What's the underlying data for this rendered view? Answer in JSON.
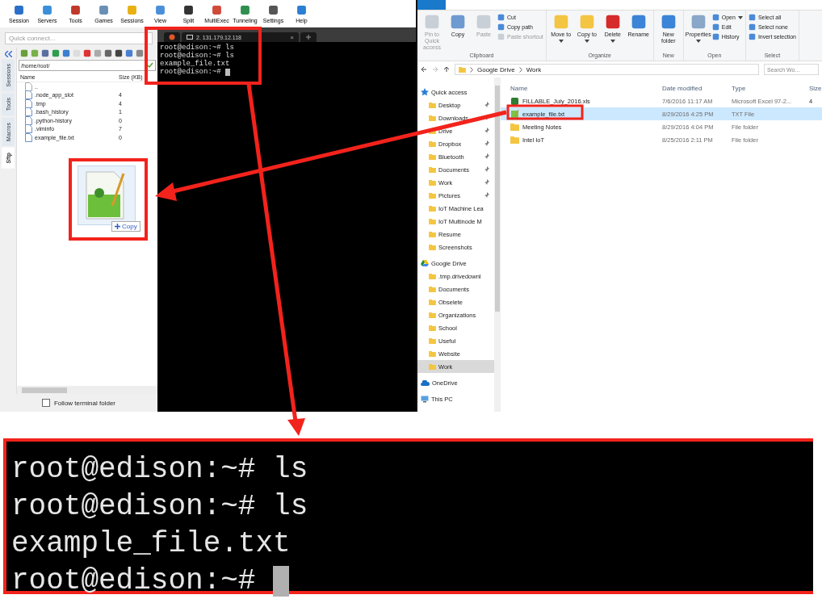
{
  "mobaxterm": {
    "toolbar": [
      "Session",
      "Servers",
      "Tools",
      "Games",
      "Sessions",
      "View",
      "Split",
      "MultiExec",
      "Tunneling",
      "Settings",
      "Help"
    ],
    "quick_connect_placeholder": "Quick connect...",
    "side_tabs": [
      {
        "label": "Sessions",
        "selected": false
      },
      {
        "label": "Tools",
        "selected": false
      },
      {
        "label": "Macros",
        "selected": false
      },
      {
        "label": "Sftp",
        "selected": true
      }
    ],
    "path": "/home/root/",
    "columns": [
      "Name",
      "Size (KB)"
    ],
    "files": [
      {
        "name": "..",
        "kind": "up"
      },
      {
        "name": ".node_app_slot",
        "size": "4",
        "kind": "file"
      },
      {
        "name": ".tmp",
        "size": "4",
        "kind": "file"
      },
      {
        "name": ".bash_history",
        "size": "1",
        "kind": "file"
      },
      {
        "name": ".python-history",
        "size": "0",
        "kind": "file"
      },
      {
        "name": ".viminfo",
        "size": "7",
        "kind": "file"
      },
      {
        "name": "example_file.txt",
        "size": "0",
        "kind": "file"
      }
    ],
    "drag_badge": "Copy",
    "follow_folder": {
      "label": "Follow terminal folder",
      "checked": false
    }
  },
  "terminal": {
    "tab_title": "2. 131.179.12.118",
    "close_glyph": "×",
    "lines": [
      "root@edison:~# ls",
      "root@edison:~# ls",
      "example_file.txt",
      "root@edison:~#"
    ]
  },
  "explorer": {
    "ribbon": [
      {
        "label": "Clipboard",
        "items": [
          {
            "kind": "large",
            "label": "Pin to Quick access",
            "disabled": true,
            "dropdown": false
          },
          {
            "kind": "large",
            "label": "Copy",
            "disabled": false,
            "dropdown": false
          },
          {
            "kind": "large",
            "label": "Paste",
            "disabled": true,
            "dropdown": false
          },
          {
            "kind": "small",
            "label": "Cut",
            "disabled": false,
            "dropdown": false
          },
          {
            "kind": "small",
            "label": "Copy path",
            "disabled": false,
            "dropdown": false
          },
          {
            "kind": "small",
            "label": "Paste shortcut",
            "disabled": true,
            "dropdown": false
          }
        ]
      },
      {
        "label": "Organize",
        "items": [
          {
            "kind": "large",
            "label": "Move to",
            "disabled": false,
            "dropdown": true
          },
          {
            "kind": "large",
            "label": "Copy to",
            "disabled": false,
            "dropdown": true
          },
          {
            "kind": "large",
            "label": "Delete",
            "disabled": false,
            "dropdown": true
          },
          {
            "kind": "large",
            "label": "Rename",
            "disabled": false,
            "dropdown": false
          }
        ]
      },
      {
        "label": "New",
        "items": [
          {
            "kind": "large",
            "label": "New folder",
            "disabled": false,
            "dropdown": false
          }
        ]
      },
      {
        "label": "Open",
        "items": [
          {
            "kind": "large",
            "label": "Properties",
            "disabled": false,
            "dropdown": true
          },
          {
            "kind": "small",
            "label": "Open",
            "disabled": false,
            "dropdown": true
          },
          {
            "kind": "small",
            "label": "Edit",
            "disabled": false,
            "dropdown": false
          },
          {
            "kind": "small",
            "label": "History",
            "disabled": false,
            "dropdown": false
          }
        ]
      },
      {
        "label": "Select",
        "items": [
          {
            "kind": "small",
            "label": "Select all",
            "disabled": false,
            "dropdown": false
          },
          {
            "kind": "small",
            "label": "Select none",
            "disabled": false,
            "dropdown": false
          },
          {
            "kind": "small",
            "label": "Invert selection",
            "disabled": false,
            "dropdown": false
          }
        ]
      }
    ],
    "breadcrumbs": [
      "Google Drive",
      "Work"
    ],
    "search_placeholder": "Search Wo...",
    "nav": [
      {
        "label": "Quick access",
        "kind": "quick_access",
        "selected": false,
        "children": [
          {
            "label": "Desktop",
            "pinned": true,
            "selected": false
          },
          {
            "label": "Downloads",
            "pinned": true,
            "selected": false
          },
          {
            "label": "Drive",
            "pinned": true,
            "selected": false
          },
          {
            "label": "Dropbox",
            "pinned": true,
            "selected": false
          },
          {
            "label": "Bluetooth",
            "pinned": true,
            "selected": false
          },
          {
            "label": "Documents",
            "pinned": true,
            "selected": false
          },
          {
            "label": "Work",
            "pinned": true,
            "selected": false
          },
          {
            "label": "Pictures",
            "pinned": true,
            "selected": false
          },
          {
            "label": "IoT Machine Lea",
            "pinned": false,
            "selected": false
          },
          {
            "label": "IoT Multinode M",
            "pinned": false,
            "selected": false
          },
          {
            "label": "Resume",
            "pinned": false,
            "selected": false
          },
          {
            "label": "Screenshots",
            "pinned": false,
            "selected": false
          }
        ]
      },
      {
        "label": "Google Drive",
        "kind": "google_drive",
        "selected": false,
        "children": [
          {
            "label": ".tmp.drivedownl",
            "pinned": false,
            "selected": false
          },
          {
            "label": "Documents",
            "pinned": false,
            "selected": false
          },
          {
            "label": "Obselete",
            "pinned": false,
            "selected": false
          },
          {
            "label": "Organizations",
            "pinned": false,
            "selected": false
          },
          {
            "label": "School",
            "pinned": false,
            "selected": false
          },
          {
            "label": "Useful",
            "pinned": false,
            "selected": false
          },
          {
            "label": "Website",
            "pinned": false,
            "selected": false
          },
          {
            "label": "Work",
            "pinned": false,
            "selected": true
          }
        ]
      },
      {
        "label": "OneDrive",
        "kind": "onedrive",
        "selected": false
      },
      {
        "label": "This PC",
        "kind": "pc",
        "selected": false
      }
    ],
    "columns": [
      "Name",
      "Date modified",
      "Type",
      "Size"
    ],
    "rows": [
      {
        "name": "FILLABLE_July_2016.xls",
        "date": "7/6/2016 11:17 AM",
        "type": "Microsoft Excel 97-2...",
        "size": "4",
        "kind": "excel",
        "selected": false
      },
      {
        "name": "example_file.txt",
        "date": "8/29/2016 4:25 PM",
        "type": "TXT File",
        "kind": "text",
        "selected": true
      },
      {
        "name": "Meeting Notes",
        "date": "8/29/2016 4:04 PM",
        "type": "File folder",
        "kind": "folder",
        "selected": false
      },
      {
        "name": "Intel IoT",
        "date": "8/25/2016 2:11 PM",
        "type": "File folder",
        "kind": "folder",
        "selected": false
      }
    ]
  },
  "zoomed_terminal": {
    "lines": [
      "root@edison:~# ls",
      "root@edison:~# ls",
      "example_file.txt",
      "root@edison:~#"
    ]
  }
}
